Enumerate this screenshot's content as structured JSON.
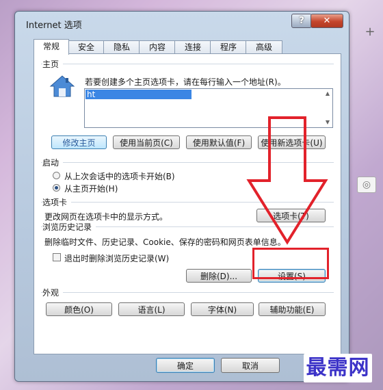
{
  "window": {
    "title": "Internet 选项",
    "help_label": "?",
    "close_label": "✕"
  },
  "tabs": [
    {
      "label": "常规",
      "active": true
    },
    {
      "label": "安全"
    },
    {
      "label": "隐私"
    },
    {
      "label": "内容"
    },
    {
      "label": "连接"
    },
    {
      "label": "程序"
    },
    {
      "label": "高级"
    }
  ],
  "homepage": {
    "group_label": "主页",
    "instruction": "若要创建多个主页选项卡，请在每行输入一个地址(R)。",
    "url_value": "ht",
    "buttons": {
      "modify": "修改主页",
      "use_current": "使用当前页(C)",
      "use_default": "使用默认值(F)",
      "use_new_tab": "使用新选项卡(U)"
    }
  },
  "startup": {
    "group_label": "启动",
    "option_last_session": "从上次会话中的选项卡开始(B)",
    "option_homepage": "从主页开始(H)"
  },
  "tabs_section": {
    "group_label": "选项卡",
    "description": "更改网页在选项卡中的显示方式。",
    "button": "选项卡(T)"
  },
  "history": {
    "group_label": "浏览历史记录",
    "description": "删除临时文件、历史记录、Cookie、保存的密码和网页表单信息。",
    "checkbox_label": "退出时删除浏览历史记录(W)",
    "delete_button": "删除(D)...",
    "settings_button": "设置(S)"
  },
  "appearance": {
    "group_label": "外观",
    "colors": "颜色(O)",
    "languages": "语言(L)",
    "fonts": "字体(N)",
    "accessibility": "辅助功能(E)"
  },
  "footer": {
    "ok": "确定",
    "cancel": "取消"
  },
  "watermark": "最需网",
  "colors": {
    "annotation_red": "#e2222b",
    "url_highlight": "#3b86e4",
    "watermark_blue": "#3c33c8"
  }
}
